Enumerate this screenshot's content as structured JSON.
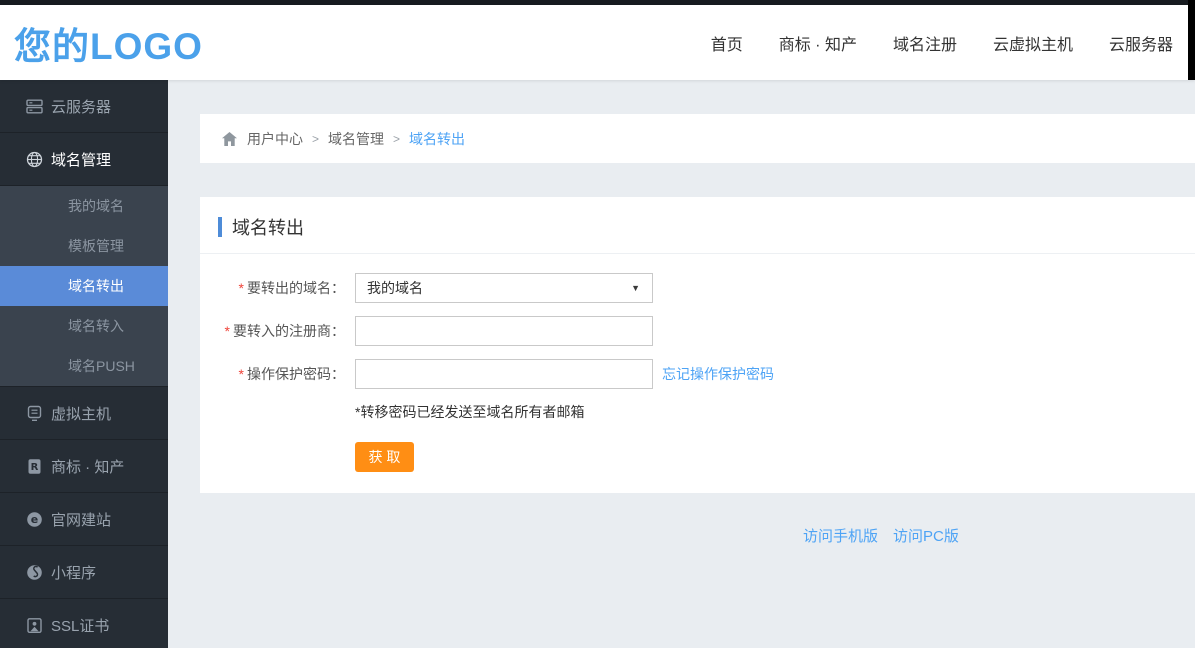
{
  "header": {
    "logo": "您的LOGO",
    "nav": [
      "首页",
      "商标 · 知产",
      "域名注册",
      "云虚拟主机",
      "云服务器"
    ]
  },
  "sidebar": {
    "items": [
      {
        "label": "云服务器",
        "icon": "server-icon"
      },
      {
        "label": "域名管理",
        "icon": "globe-icon",
        "active": true
      },
      {
        "label": "虚拟主机",
        "icon": "host-icon"
      },
      {
        "label": "商标 · 知产",
        "icon": "trademark-icon"
      },
      {
        "label": "官网建站",
        "icon": "browser-icon"
      },
      {
        "label": "小程序",
        "icon": "miniprogram-icon"
      },
      {
        "label": "SSL证书",
        "icon": "certificate-icon"
      }
    ],
    "submenu": {
      "items": [
        "我的域名",
        "模板管理",
        "域名转出",
        "域名转入",
        "域名PUSH"
      ],
      "active_index": 2
    }
  },
  "breadcrumb": {
    "home_icon": "home-icon",
    "separator": ">",
    "items": [
      "用户中心",
      "域名管理",
      "域名转出"
    ]
  },
  "main": {
    "title": "域名转出",
    "form": {
      "required_mark": "*",
      "select_caret": "▼",
      "fields": [
        {
          "label": "要转出的域名：",
          "control": "select",
          "value": "我的域名"
        },
        {
          "label": "要转入的注册商：",
          "control": "input",
          "value": ""
        },
        {
          "label": "操作保护密码：",
          "control": "input",
          "value": "",
          "link": "忘记操作保护密码"
        }
      ],
      "note": "*转移密码已经发送至域名所有者邮箱",
      "submit_label": "获 取"
    }
  },
  "footer": {
    "links": [
      "访问手机版",
      "访问PC版"
    ]
  },
  "colors": {
    "brand_blue": "#4ba1ea",
    "link_blue": "#4da3f5",
    "accent_bar_blue": "#4e8cd8",
    "sidebar_active_blue": "#5a8bd8",
    "button_orange": "#ff8e14",
    "required_red": "#ef4339",
    "sidebar_bg": "#262d35",
    "submenu_bg": "#3a434e",
    "body_bg": "#e9edf1"
  }
}
